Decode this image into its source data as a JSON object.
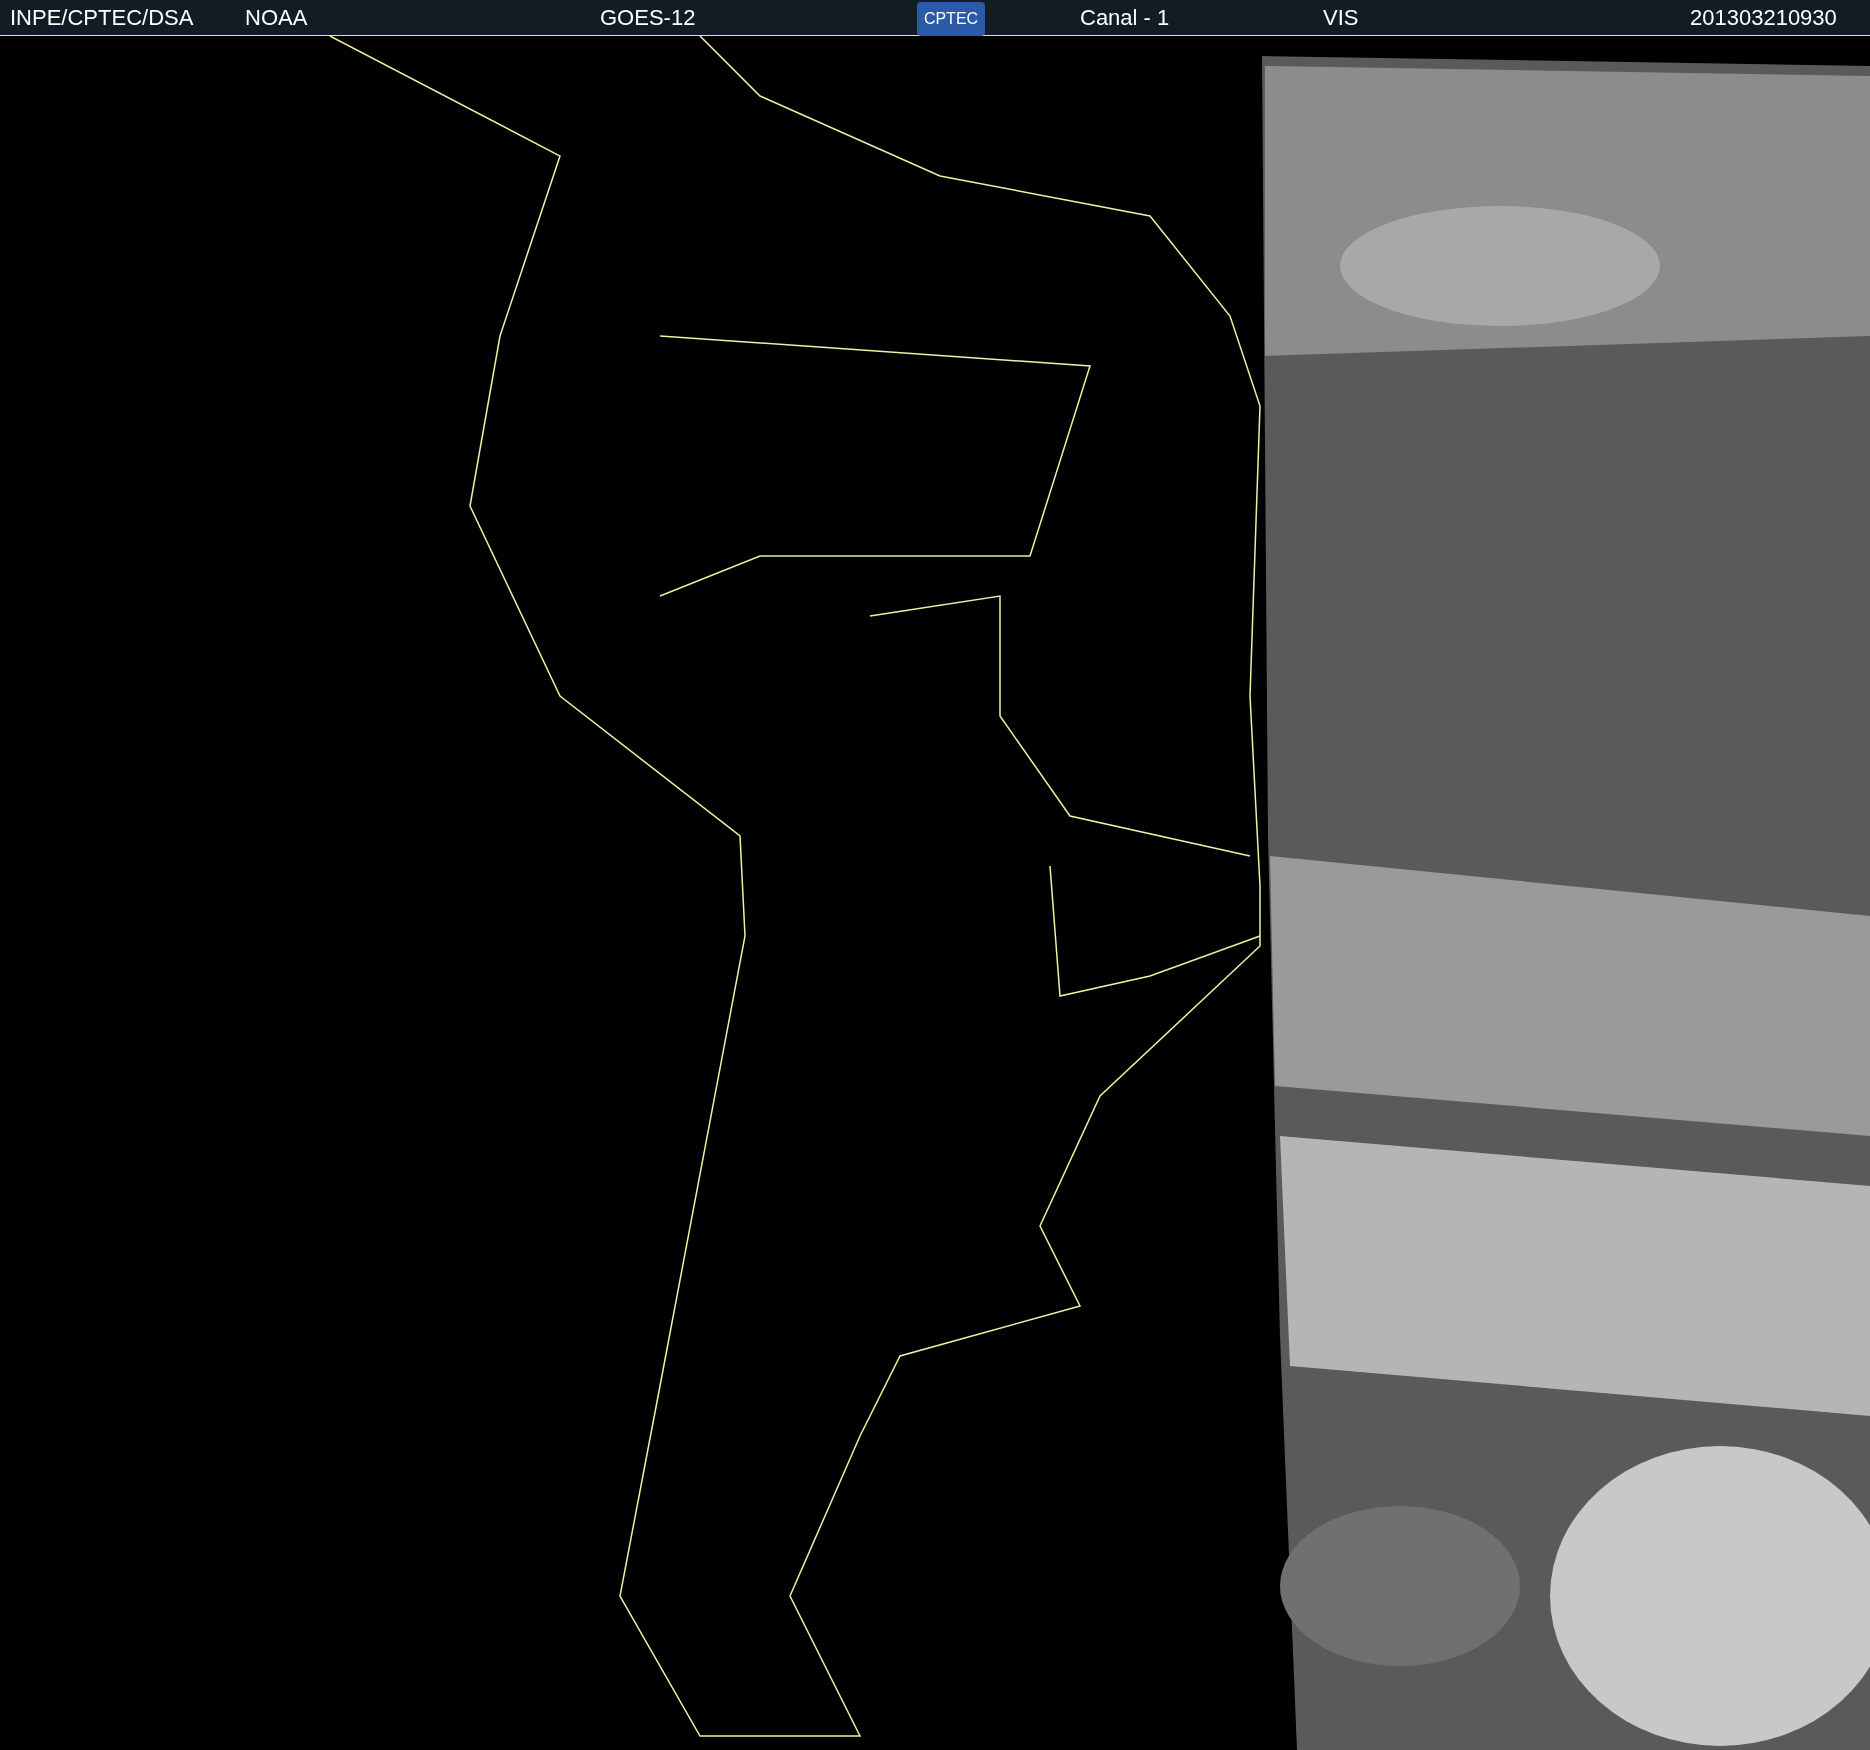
{
  "header": {
    "source": "INPE/CPTEC/DSA",
    "agency": "NOAA",
    "satellite": "GOES-12",
    "logo_text": "CPTEC",
    "channel": "Canal - 1",
    "band": "VIS",
    "timestamp": "201303210930"
  }
}
